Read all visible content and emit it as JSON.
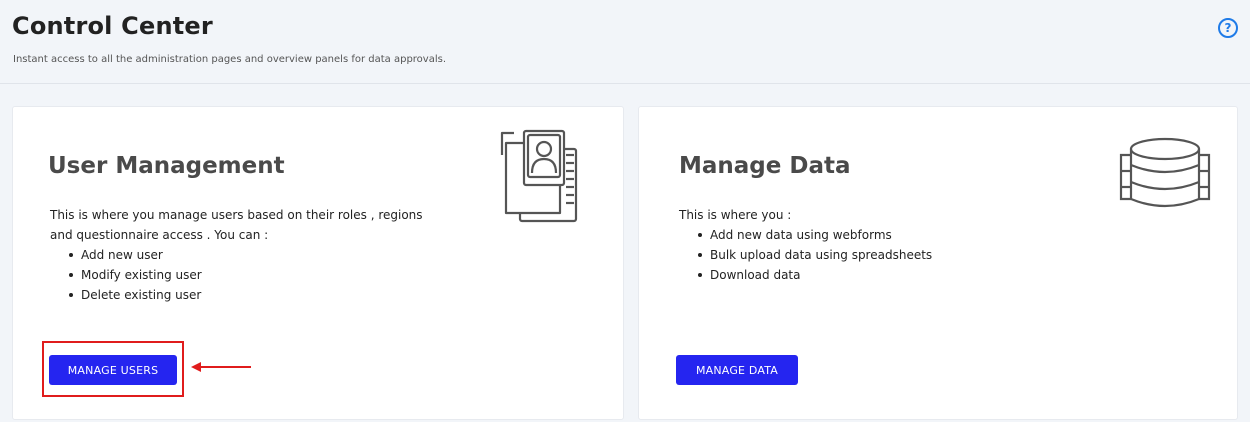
{
  "header": {
    "title": "Control Center",
    "subtitle": "Instant access to all the administration pages and overview panels for data approvals.",
    "help_label": "?"
  },
  "cards": [
    {
      "title": "User Management",
      "icon": "user-document-icon",
      "description": "This is where you manage users based on their roles , regions and questionnaire access . You can :",
      "items": [
        "Add new user",
        "Modify existing user",
        "Delete existing user"
      ],
      "button_label": "MANAGE USERS"
    },
    {
      "title": "Manage Data",
      "icon": "database-icon",
      "description": "This is where you :",
      "items": [
        "Add new data using webforms",
        "Bulk upload data using spreadsheets",
        "Download data"
      ],
      "button_label": "MANAGE DATA"
    }
  ],
  "colors": {
    "primary_button": "#2525f0",
    "highlight": "#e01c1c",
    "help_icon": "#1f7be8"
  }
}
